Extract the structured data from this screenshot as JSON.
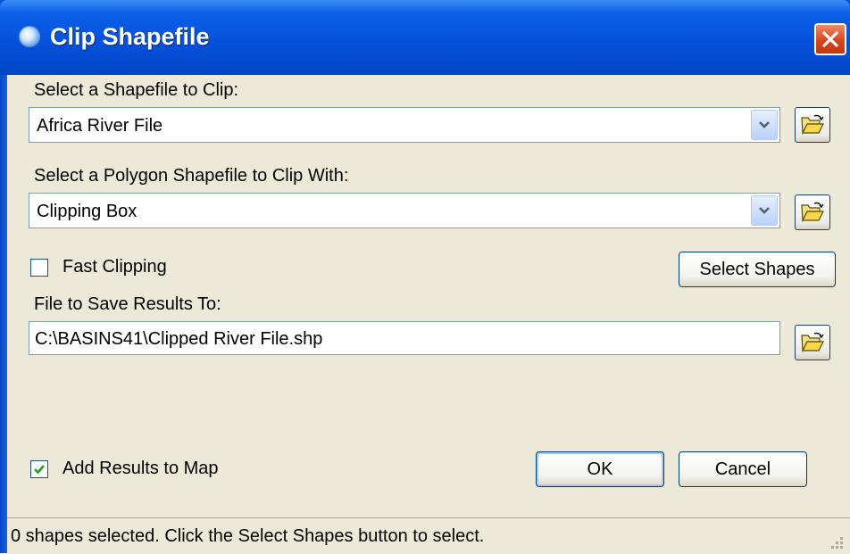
{
  "window": {
    "title": "Clip Shapefile"
  },
  "form": {
    "shapefile_label": "Select a Shapefile to Clip:",
    "shapefile_value": "Africa River File",
    "polygon_label": "Select a Polygon Shapefile to Clip With:",
    "polygon_value": "Clipping Box",
    "fast_clipping_label": "Fast Clipping",
    "fast_clipping_checked": false,
    "select_shapes_label": "Select Shapes",
    "save_label": "File to Save Results To:",
    "save_value": "C:\\BASINS41\\Clipped River File.shp",
    "add_results_label": "Add Results to Map",
    "add_results_checked": true,
    "ok_label": "OK",
    "cancel_label": "Cancel"
  },
  "status": {
    "text": "0 shapes selected. Click the Select Shapes button to select."
  },
  "icons": {
    "app": "globe-icon",
    "close": "close-icon",
    "dropdown": "chevron-down-icon",
    "browse": "open-folder-icon",
    "check": "checkmark-icon",
    "grip": "resize-grip-icon"
  },
  "colors": {
    "titlebar": "#0550d9",
    "client": "#ece9d8",
    "close_button": "#d9451f",
    "check": "#21a121"
  }
}
